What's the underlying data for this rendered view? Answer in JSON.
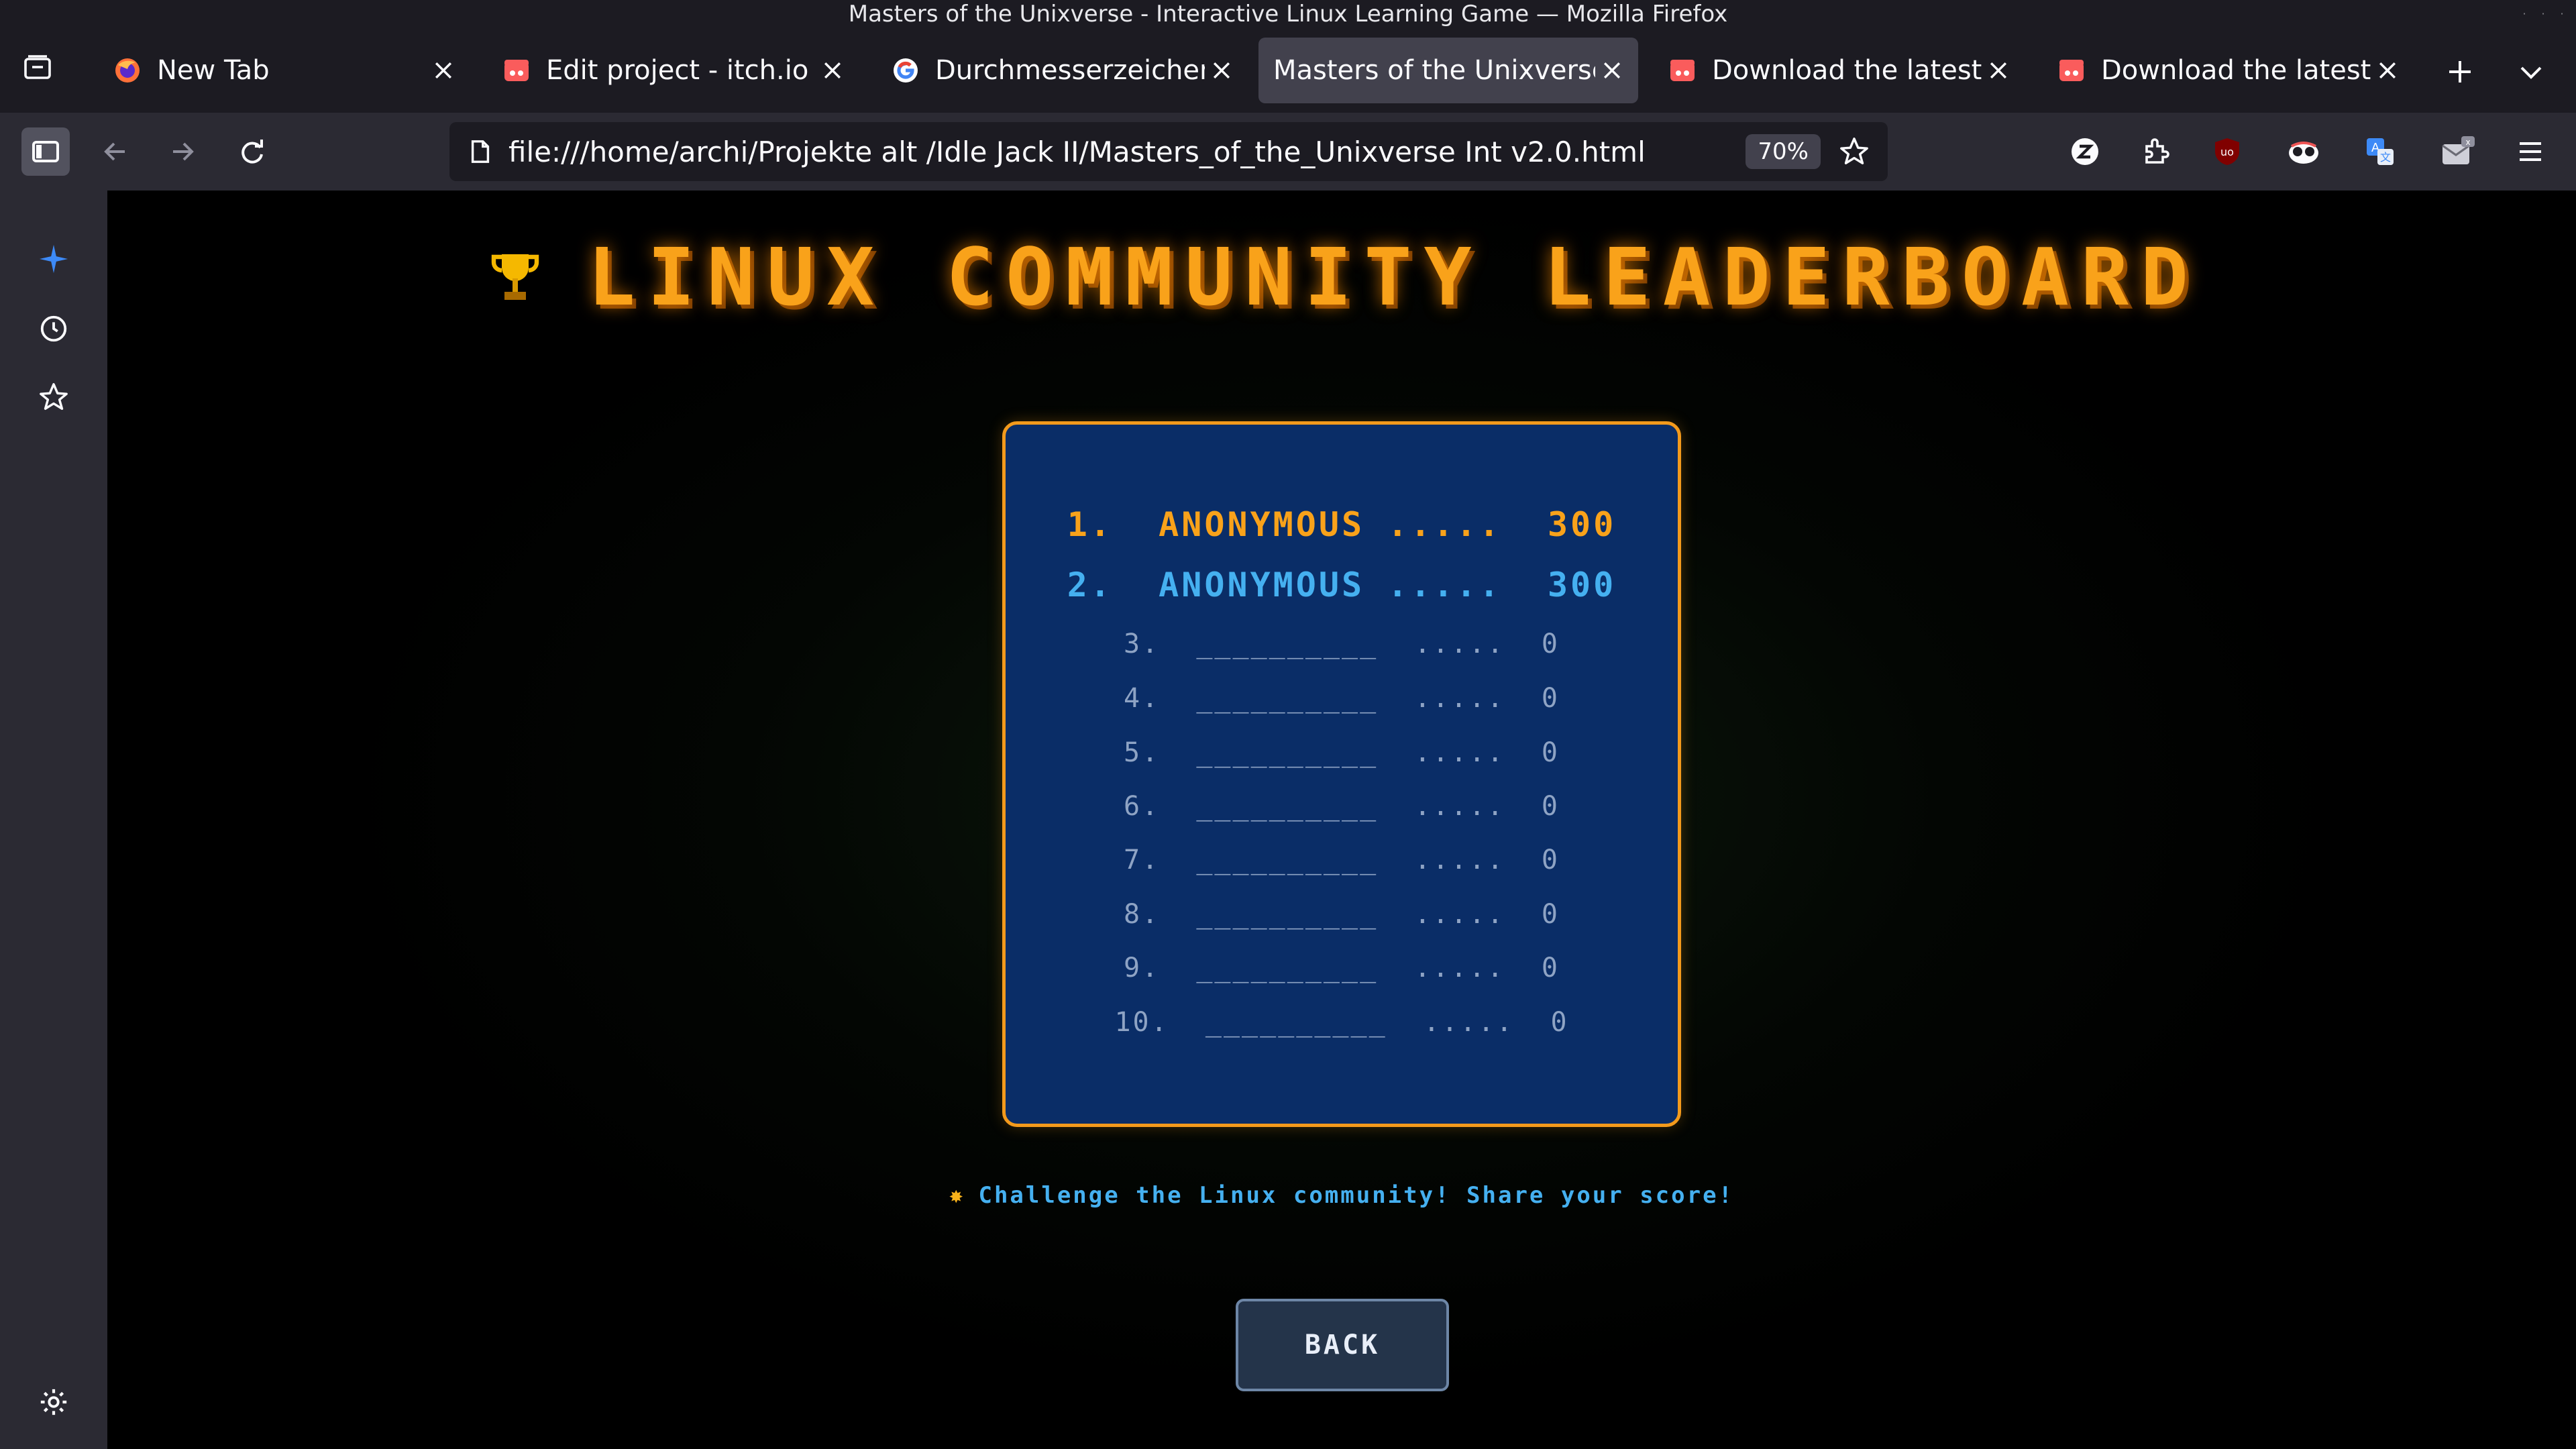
{
  "window": {
    "title": "Masters of the Unixverse - Interactive Linux Learning Game — Mozilla Firefox"
  },
  "tabs": [
    {
      "label": "New Tab",
      "favicon": "firefox-icon",
      "active": false
    },
    {
      "label": "Edit project - itch.io",
      "favicon": "itchio-icon",
      "active": false
    },
    {
      "label": "Durchmesserzeichen -",
      "favicon": "google-icon",
      "active": false
    },
    {
      "label": "Masters of the Unixverse",
      "favicon": "",
      "active": true
    },
    {
      "label": "Download the latest in",
      "favicon": "itchio-icon",
      "active": false
    },
    {
      "label": "Download the latest in",
      "favicon": "itchio-icon",
      "active": false
    }
  ],
  "navbar": {
    "url": "file:///home/archi/Projekte alt /Idle Jack II/Masters_of_the_Unixverse Int v2.0.html",
    "zoom": "70%"
  },
  "extensions": [
    "zotero-icon",
    "extensions-puzzle-icon",
    "ublock-icon",
    "privacy-badger-icon",
    "translate-icon",
    "mail-icon",
    "menu-icon"
  ],
  "leaderboard": {
    "title": "LINUX COMMUNITY LEADERBOARD",
    "entries": [
      {
        "rank": "1.",
        "name": "ANONYMOUS",
        "dots": ".....",
        "score": "300"
      },
      {
        "rank": "2.",
        "name": "ANONYMOUS",
        "dots": ".....",
        "score": "300"
      },
      {
        "rank": "3.",
        "name": "__________",
        "dots": ".....",
        "score": "0"
      },
      {
        "rank": "4.",
        "name": "__________",
        "dots": ".....",
        "score": "0"
      },
      {
        "rank": "5.",
        "name": "__________",
        "dots": ".....",
        "score": "0"
      },
      {
        "rank": "6.",
        "name": "__________",
        "dots": ".....",
        "score": "0"
      },
      {
        "rank": "7.",
        "name": "__________",
        "dots": ".....",
        "score": "0"
      },
      {
        "rank": "8.",
        "name": "__________",
        "dots": ".....",
        "score": "0"
      },
      {
        "rank": "9.",
        "name": "__________",
        "dots": ".....",
        "score": "0"
      },
      {
        "rank": "10.",
        "name": "__________",
        "dots": ".....",
        "score": "0"
      }
    ],
    "challenge_text": "Challenge the Linux community! Share your score!",
    "back_label": "BACK"
  },
  "colors": {
    "gold": "#f9a21a",
    "blue": "#45b0f0",
    "panel": "#0a2d67"
  }
}
